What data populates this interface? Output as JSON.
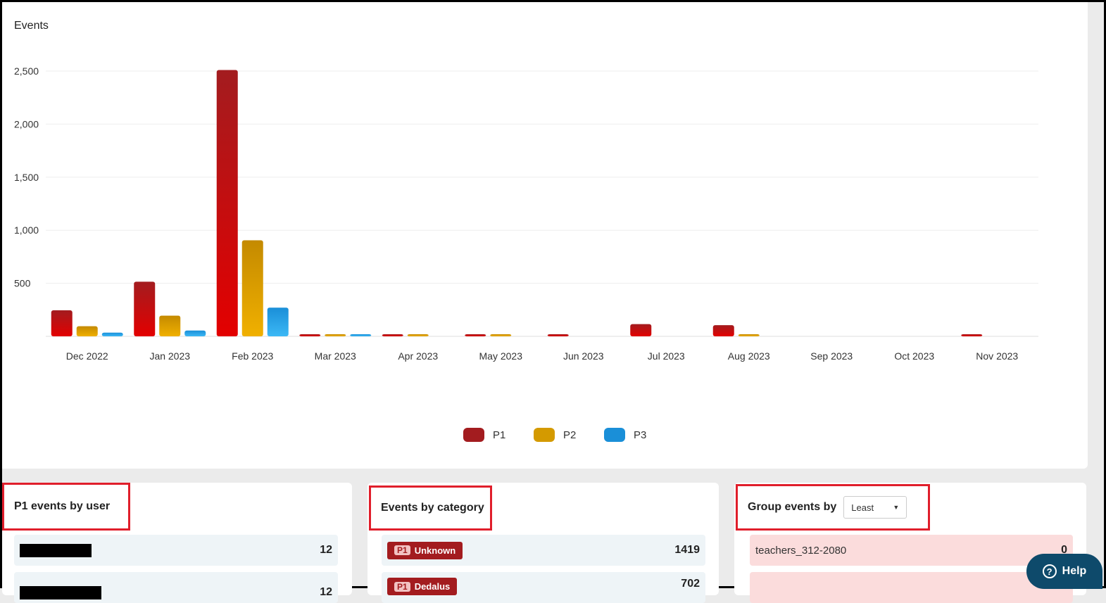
{
  "chart_data": {
    "type": "bar",
    "title": "Events",
    "categories": [
      "Dec 2022",
      "Jan 2023",
      "Feb 2023",
      "Mar 2023",
      "Apr 2023",
      "May 2023",
      "Jun 2023",
      "Jul 2023",
      "Aug 2023",
      "Sep 2023",
      "Oct 2023",
      "Nov 2023"
    ],
    "series": [
      {
        "name": "P1",
        "color": "#a31c1f",
        "values": [
          245,
          515,
          2510,
          18,
          12,
          15,
          15,
          115,
          105,
          0,
          0,
          10
        ]
      },
      {
        "name": "P2",
        "color": "#d49a00",
        "values": [
          95,
          195,
          905,
          20,
          10,
          12,
          0,
          0,
          15,
          0,
          0,
          0
        ]
      },
      {
        "name": "P3",
        "color": "#1a8fd8",
        "values": [
          35,
          55,
          270,
          12,
          0,
          0,
          0,
          0,
          0,
          0,
          0,
          0
        ]
      }
    ],
    "yticks": [
      "500",
      "1,000",
      "1,500",
      "2,000",
      "2,500"
    ],
    "ylim": [
      0,
      2500
    ],
    "legend_position": "bottom-center",
    "grid": true
  },
  "cards": {
    "p1_by_user": {
      "title": "P1 events by user",
      "rows": [
        {
          "value": "12"
        },
        {
          "value": "12"
        }
      ]
    },
    "by_category": {
      "title": "Events by category",
      "rows": [
        {
          "priority": "P1",
          "label": "Unknown",
          "value": "1419"
        },
        {
          "priority": "P1",
          "label": "Dedalus",
          "value": "702"
        }
      ]
    },
    "group_events": {
      "title": "Group events by",
      "select_value": "Least",
      "rows": [
        {
          "label": "teachers_312-2080",
          "value": "0"
        }
      ]
    }
  },
  "help": {
    "label": "Help",
    "icon": "question-icon"
  }
}
